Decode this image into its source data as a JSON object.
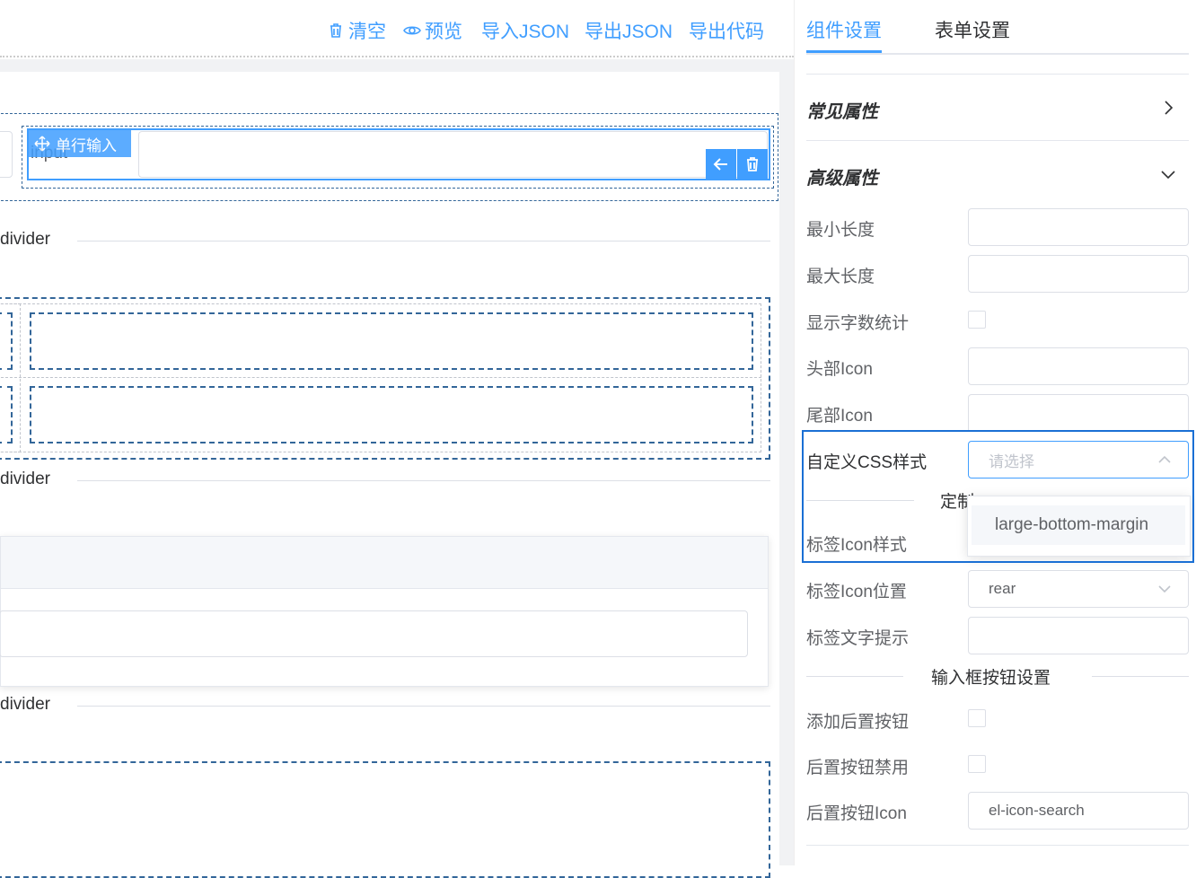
{
  "toolbar": {
    "clear": "清空",
    "preview": "预览",
    "import_json": "导入JSON",
    "export_json": "导出JSON",
    "export_code": "导出代码"
  },
  "canvas": {
    "selected_widget_tag": "单行输入",
    "input_label": "input",
    "dividers": [
      "divider",
      "divider",
      "divider"
    ]
  },
  "right_panel": {
    "tabs": [
      "组件设置",
      "表单设置"
    ],
    "active_tab": "组件设置",
    "sections": {
      "common": "常见属性",
      "advanced": "高级属性"
    },
    "props": {
      "min_length": "最小长度",
      "max_length": "最大长度",
      "show_word_limit": "显示字数统计",
      "prefix_icon": "头部Icon",
      "suffix_icon": "尾部Icon",
      "custom_css": "自定义CSS样式",
      "custom_css_placeholder": "请选择",
      "custom_label_partial": "定制",
      "label_icon_class": "标签Icon样式",
      "label_icon_position": "标签Icon位置",
      "label_icon_position_value": "rear",
      "label_tooltip": "标签文字提示",
      "input_button_settings": "输入框按钮设置",
      "append_button": "添加后置按钮",
      "append_button_disabled": "后置按钮禁用",
      "append_button_icon": "后置按钮Icon",
      "append_button_icon_value": "el-icon-search"
    },
    "dropdown_options": [
      "large-bottom-margin"
    ]
  },
  "colors": {
    "accent": "#409eff",
    "highlight": "#1a6fd4",
    "dashed": "#336699"
  }
}
